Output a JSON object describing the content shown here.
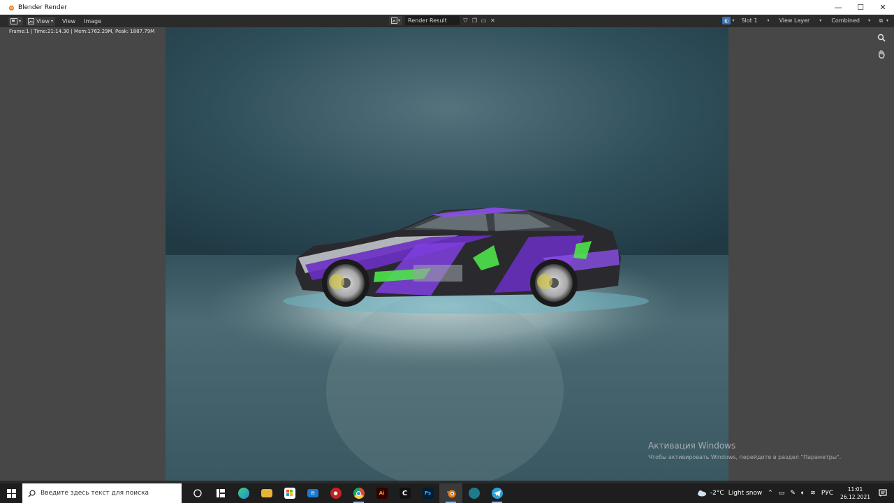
{
  "window": {
    "title": "Blender Render",
    "minimize": "—",
    "maximize": "☐",
    "close": "✕"
  },
  "header": {
    "menu": [
      "View",
      "View",
      "Image"
    ],
    "image_name": "Render Result",
    "slot": "Slot 1",
    "view_layer": "View Layer",
    "pass": "Combined"
  },
  "viewport": {
    "stats": "Frame:1 | Time:21:14.30 | Mem:1762.29M, Peak: 1887.79M"
  },
  "watermark": {
    "title": "Активация Windows",
    "subtitle": "Чтобы активировать Windows, перейдите в раздел \"Параметры\"."
  },
  "taskbar": {
    "search_placeholder": "Введите здесь текст для поиска",
    "apps": [
      {
        "name": "task-view",
        "label": "",
        "color": "#1e1e1e"
      },
      {
        "name": "edge",
        "label": "e",
        "color": "#1f8fd6"
      },
      {
        "name": "file-explorer",
        "label": "",
        "color": "#e8b433"
      },
      {
        "name": "microsoft-store",
        "label": "",
        "color": "#2b6fd1"
      },
      {
        "name": "mail",
        "label": "",
        "color": "#1b79d1"
      },
      {
        "name": "app-red",
        "label": "",
        "color": "#c62121"
      },
      {
        "name": "chrome",
        "label": "",
        "color": "#dd4b39"
      },
      {
        "name": "illustrator",
        "label": "Ai",
        "color": "#330000"
      },
      {
        "name": "capcut",
        "label": "C",
        "color": "#111111"
      },
      {
        "name": "photoshop",
        "label": "Ps",
        "color": "#001e36"
      },
      {
        "name": "blender",
        "label": "",
        "color": "#e87d0d"
      },
      {
        "name": "app-teal",
        "label": "",
        "color": "#1f7a8c"
      },
      {
        "name": "telegram",
        "label": "",
        "color": "#2aa1da"
      }
    ],
    "weather_temp": "-2°C",
    "weather_text": "Light snow",
    "language": "РУС",
    "time": "11:01",
    "date": "26.12.2021"
  }
}
